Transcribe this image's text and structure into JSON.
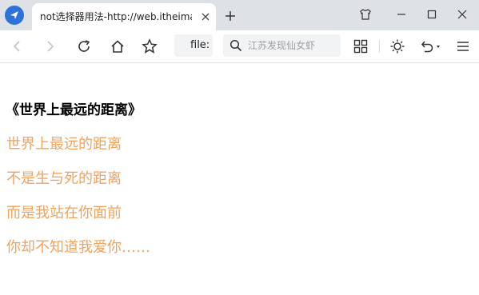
{
  "browser": {
    "tab": {
      "title": "not选择器用法-http://web.itheima"
    },
    "address": {
      "url": "file:"
    },
    "search": {
      "placeholder": "江苏发现仙女虾"
    }
  },
  "page": {
    "heading": "《世界上最远的距离》",
    "lines": [
      "世界上最远的距离",
      "不是生与死的距离",
      "而是我站在你面前",
      "你却不知道我爱你……"
    ],
    "line_color": "#f0a35e"
  },
  "icons": {
    "logo": "paper-plane-logo-icon",
    "tab_close": "close-icon",
    "new_tab": "plus-icon",
    "window": [
      "skin-shirt-icon",
      "minimize-icon",
      "maximize-icon",
      "close-icon"
    ],
    "toolbar": [
      "back-arrow-icon",
      "forward-arrow-icon",
      "refresh-icon",
      "home-icon",
      "bookmark-star-icon",
      "search-icon",
      "apps-grid-icon",
      "brightness-sun-icon",
      "undo-dropdown-icon",
      "menu-hamburger-icon"
    ]
  }
}
